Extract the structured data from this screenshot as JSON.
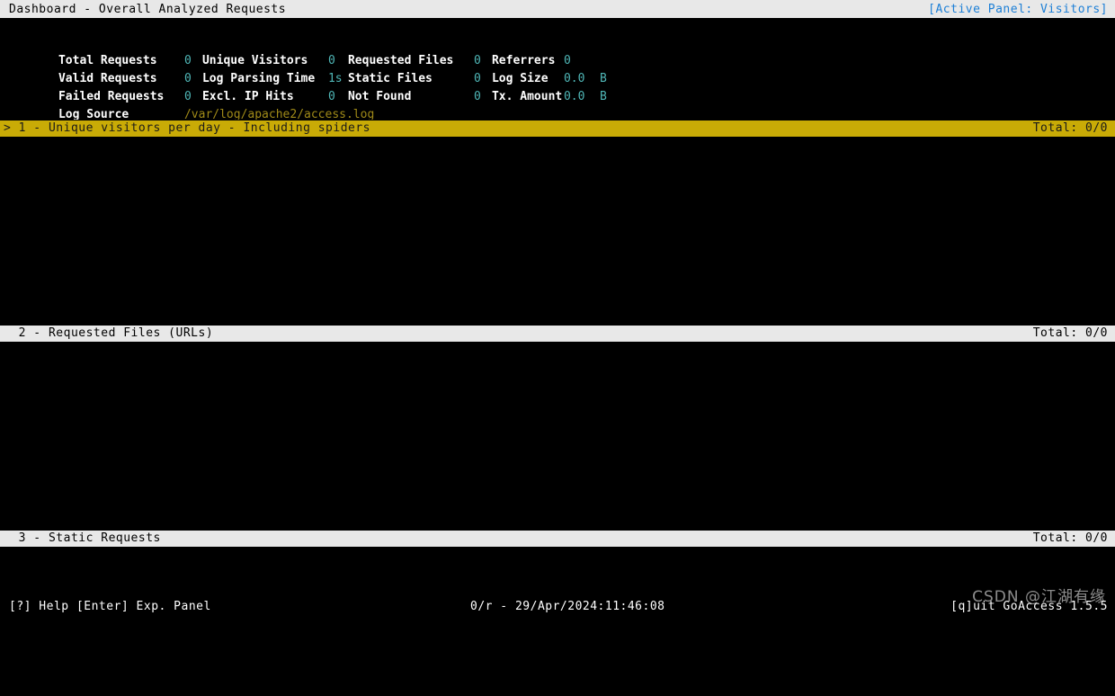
{
  "titlebar": {
    "title": "Dashboard - Overall Analyzed Requests",
    "active_panel": "[Active Panel: Visitors]"
  },
  "overview": {
    "rows": [
      {
        "label1": "Total Requests",
        "value1": "0",
        "label2": "Unique Visitors",
        "value2": "0",
        "label3": "Requested Files",
        "value3": "0",
        "label4": "Referrers",
        "value4": "0",
        "unit4": ""
      },
      {
        "label1": "Valid Requests",
        "value1": "0",
        "label2": "Log Parsing Time",
        "value2": "1s",
        "label3": "Static Files",
        "value3": "0",
        "label4": "Log Size",
        "value4": "0.0",
        "unit4": "B"
      },
      {
        "label1": "Failed Requests",
        "value1": "0",
        "label2": "Excl. IP Hits",
        "value2": "0",
        "label3": "Not Found",
        "value3": "0",
        "label4": "Tx. Amount",
        "value4": "0.0",
        "unit4": "B"
      }
    ],
    "log_source_label": "Log Source",
    "log_source_value": "/var/log/apache2/access.log"
  },
  "panels": [
    {
      "left": "> 1 - Unique visitors per day - Including spiders",
      "right": "Total: 0/0",
      "active": true
    },
    {
      "left": "  2 - Requested Files (URLs)",
      "right": "Total: 0/0",
      "active": false
    },
    {
      "left": "  3 - Static Requests",
      "right": "Total: 0/0",
      "active": false
    }
  ],
  "statusbar": {
    "left": "[?] Help [Enter] Exp. Panel",
    "middle": "0/r - 29/Apr/2024:11:46:08",
    "right": "[q]uit GoAccess 1.5.5"
  },
  "watermark": "CSDN @江湖有缘",
  "colors": {
    "background": "#000000",
    "title_bar": "#e8e8e8",
    "active_panel_text": "#1d7fd6",
    "active_panel_bar": "#c9ab06",
    "inactive_panel_bar": "#e8e8e8",
    "stat_value": "#4fb6b6",
    "log_path": "#a08a18",
    "foreground": "#ffffff"
  }
}
